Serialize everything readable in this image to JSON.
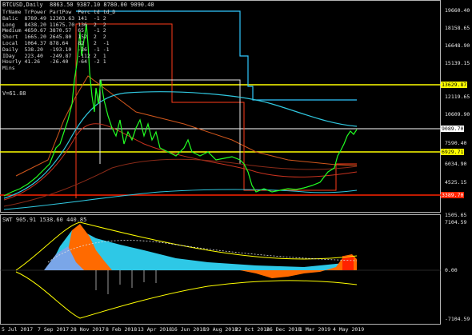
{
  "chart_title": "BTCUSD,Daily  8863.50 9387.10 8780.00 9090.40",
  "stats_table": {
    "headers": [
      "TrName",
      "TrPower",
      "PartPow",
      "Perc",
      "td",
      "td_D"
    ],
    "rows": [
      [
        "Balic",
        "8789.49",
        "12303.63",
        "141",
        "-1",
        "2"
      ],
      [
        "Long",
        "8438.20",
        "11675.70",
        "136",
        "2",
        "2"
      ],
      [
        "Medium",
        "4650.67",
        "3870.57",
        "65",
        "-1",
        "2"
      ],
      [
        "Short",
        "1665.20",
        "2645.80",
        "152",
        "2",
        "2"
      ],
      [
        "Local",
        "1064.37",
        "878.64",
        "82",
        "2",
        "-1"
      ],
      [
        "Daily",
        "538.20",
        "-193.10",
        "-36",
        "-1",
        "-1"
      ],
      [
        "IDay",
        "223.40",
        "-249.87",
        "-112",
        "2",
        "1"
      ],
      [
        "Hourly",
        "41.26",
        "-26.40",
        "-64",
        "-2",
        "1"
      ],
      [
        "Mins",
        "",
        "",
        "",
        "",
        ""
      ]
    ],
    "extra": "V=61.88"
  },
  "price_axis": [
    "19660.40",
    "18158.65",
    "16648.90",
    "15139.15",
    "13629.40",
    "12119.65",
    "10609.90",
    "9100.15",
    "7590.40",
    "6034.90",
    "4525.15",
    "3015.40",
    "1505.65"
  ],
  "price_labels": [
    {
      "text": "13629.87",
      "bg": "#ffff00",
      "fg": "#000000"
    },
    {
      "text": "9089.70",
      "bg": "#ffffff",
      "fg": "#000000"
    },
    {
      "text": "6929.71",
      "bg": "#ffff00",
      "fg": "#000000"
    },
    {
      "text": "3389.70",
      "bg": "#ff2200",
      "fg": "#ffffff"
    }
  ],
  "indicator_title": "SWT 905.91 1538.60 440.85",
  "indicator_axis": [
    "7104.59",
    "0.00",
    "-7104.59"
  ],
  "date_axis": [
    "5 Jul 2017",
    "7 Sep 2017",
    "28 Nov 2017",
    "8 Feb 2018",
    "13 Apr 2018",
    "16 Jun 2018",
    "19 Aug 2018",
    "22 Oct 2018",
    "26 Dec 2018",
    "1 Mar 2019",
    "4 May 2019"
  ]
}
